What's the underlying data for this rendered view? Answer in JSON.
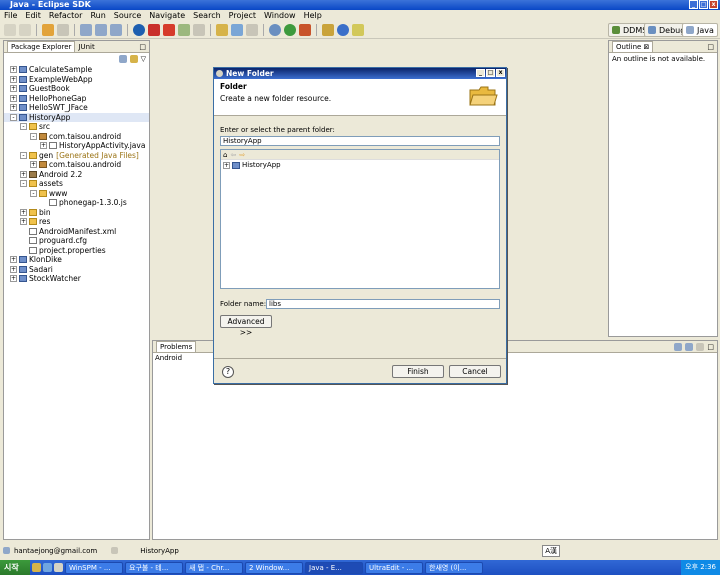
{
  "window": {
    "title": "Java - Eclipse SDK"
  },
  "menu": [
    "File",
    "Edit",
    "Refactor",
    "Run",
    "Source",
    "Navigate",
    "Search",
    "Project",
    "Window",
    "Help"
  ],
  "perspectives": {
    "ddms": "DDMS",
    "debug": "Debug",
    "java": "Java"
  },
  "explorer": {
    "tab_package": "Package Explorer",
    "tab_junit": "JUnit",
    "items": [
      {
        "label": "CalculateSample",
        "indent": 0,
        "icon": "proj",
        "exp": "+"
      },
      {
        "label": "ExampleWebApp",
        "indent": 0,
        "icon": "proj",
        "exp": "+"
      },
      {
        "label": "GuestBook",
        "indent": 0,
        "icon": "proj",
        "exp": "+"
      },
      {
        "label": "HelloPhoneGap",
        "indent": 0,
        "icon": "proj",
        "exp": "+"
      },
      {
        "label": "HelloSWT_JFace",
        "indent": 0,
        "icon": "proj",
        "exp": "+"
      },
      {
        "label": "HistoryApp",
        "indent": 0,
        "icon": "proj",
        "exp": "-",
        "selected": true
      },
      {
        "label": "src",
        "indent": 1,
        "icon": "fold",
        "exp": "-"
      },
      {
        "label": "com.taisou.android",
        "indent": 2,
        "icon": "pkg",
        "exp": "-"
      },
      {
        "label": "HistoryAppActivity.java",
        "indent": 3,
        "icon": "file",
        "exp": "+"
      },
      {
        "label": "gen",
        "suffix": "[Generated Java Files]",
        "indent": 1,
        "icon": "fold",
        "exp": "-"
      },
      {
        "label": "com.taisou.android",
        "indent": 2,
        "icon": "pkg",
        "exp": "+"
      },
      {
        "label": "Android 2.2",
        "indent": 1,
        "icon": "jar",
        "exp": "+"
      },
      {
        "label": "assets",
        "indent": 1,
        "icon": "fold",
        "exp": "-"
      },
      {
        "label": "www",
        "indent": 2,
        "icon": "fold",
        "exp": "-"
      },
      {
        "label": "phonegap-1.3.0.js",
        "indent": 3,
        "icon": "file",
        "exp": ""
      },
      {
        "label": "bin",
        "indent": 1,
        "icon": "fold",
        "exp": "+"
      },
      {
        "label": "res",
        "indent": 1,
        "icon": "fold",
        "exp": "+"
      },
      {
        "label": "AndroidManifest.xml",
        "indent": 1,
        "icon": "file",
        "exp": ""
      },
      {
        "label": "proguard.cfg",
        "indent": 1,
        "icon": "file",
        "exp": ""
      },
      {
        "label": "project.properties",
        "indent": 1,
        "icon": "file",
        "exp": ""
      },
      {
        "label": "KlonDike",
        "indent": 0,
        "icon": "proj",
        "exp": "+"
      },
      {
        "label": "Sadari",
        "indent": 0,
        "icon": "proj",
        "exp": "+"
      },
      {
        "label": "StockWatcher",
        "indent": 0,
        "icon": "proj",
        "exp": "+"
      }
    ]
  },
  "outline": {
    "tab": "Outline",
    "message": "An outline is not available."
  },
  "bottom": {
    "tab_problems": "Problems",
    "console_label": "Android"
  },
  "dialog": {
    "title": "New Folder",
    "heading": "Folder",
    "subtitle": "Create a new folder resource.",
    "parent_label": "Enter or select the parent folder:",
    "parent_value": "HistoryApp",
    "tree_item": "HistoryApp",
    "name_label": "Folder name:",
    "name_value": "libs",
    "advanced": "Advanced >>",
    "finish": "Finish",
    "cancel": "Cancel",
    "help": "?"
  },
  "status": {
    "email": "hantaejong@gmail.com",
    "project": "HistoryApp",
    "ime": "A漢"
  },
  "taskbar": {
    "start": "시작",
    "tasks": [
      "WinSPM - ...",
      "요구불 - 테...",
      "새 탭 - Chr...",
      "2 Window...",
      "Java - E...",
      "UltraEdit - ...",
      "한새영 (이..."
    ],
    "clock": "오후 2:36"
  }
}
